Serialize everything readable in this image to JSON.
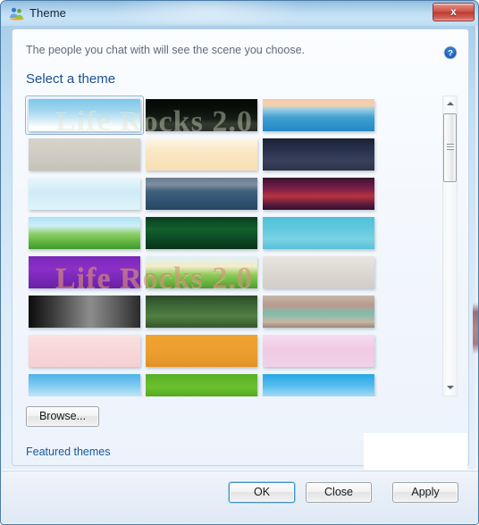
{
  "window": {
    "title": "Theme",
    "icon": "contacts-people-icon",
    "close_label": "x"
  },
  "panel": {
    "subtitle": "The people you chat with will see the scene you choose.",
    "section_title": "Select a theme",
    "help_icon": "help-question-icon"
  },
  "themes": {
    "selected_index": 0,
    "columns": 3,
    "rows_visible": 9,
    "watermark": "Life Rocks 2.0",
    "items": [
      {
        "name": "sky-blue-gradient",
        "css": "linear-gradient(to bottom,#7fc6e8 0%,#9ed6ef 34%,#cfe9f7 62%,#ffffff 88%,#f2fafd 100%)"
      },
      {
        "name": "black-dark-ridge",
        "css": "linear-gradient(to bottom,#050705 0%,#0d120d 40%,#161c16 62%,#33392f 76%,#2b2f2b 100%)"
      },
      {
        "name": "seaside-boat",
        "css": "linear-gradient(to bottom,#f7c8a8 0%,#f3d3b0 20%,#8ec9e6 34%,#3f9fd0 58%,#2489c4 100%)"
      },
      {
        "name": "grey-winter-sketch",
        "css": "linear-gradient(to bottom,#d6d3cb 0%,#cfccc3 55%,#c6c2b8 100%)"
      },
      {
        "name": "orange-bubbles-toys",
        "css": "linear-gradient(to bottom,#fdf7e8 0%,#fae7c3 40%,#f7dfb5 100%)"
      },
      {
        "name": "night-clouds",
        "css": "linear-gradient(to bottom,#1b2236 0%,#2a3350 40%,#39415c 70%,#2d3448 100%)"
      },
      {
        "name": "ice-blue-splash",
        "css": "linear-gradient(to bottom,#e9f6fb 0%,#cfecf7 45%,#dff3fa 100%)"
      },
      {
        "name": "moonlight-sea-robot",
        "css": "linear-gradient(to bottom,#6b7d90 0%,#7d8ea0 22%,#41617c 42%,#2f5472 72%,#26465f 100%)"
      },
      {
        "name": "purple-hearts",
        "css": "linear-gradient(to bottom,#3a1233 0%,#7d2049 35%,#b8343f 58%,#5d1b3e 82%,#2e1130 100%)"
      },
      {
        "name": "green-field-tree",
        "css": "linear-gradient(to bottom,#a9e2f2 0%,#cfeef7 28%,#8ed06a 52%,#5fb43f 78%,#3f9a2c 100%)"
      },
      {
        "name": "dark-green-leaves",
        "css": "linear-gradient(to bottom,#0a3d1e 0%,#12602e 38%,#0d4a24 68%,#073418 100%)"
      },
      {
        "name": "blue-bird-goggles",
        "css": "linear-gradient(to bottom,#4fc0d8 0%,#63cadf 40%,#7ad2e3 70%,#56c2d9 100%)"
      },
      {
        "name": "purple-swirl",
        "css": "linear-gradient(to bottom,#7a28b8 0%,#8b2fc9 40%,#7726b4 75%,#6a1fa4 100%)"
      },
      {
        "name": "cartoon-meadow-kid",
        "css": "linear-gradient(to bottom,#dff0f7 0%,#f3ecc9 32%,#8fca5a 58%,#69b33f 82%,#4f9c2e 100%)"
      },
      {
        "name": "graffiti-wall",
        "css": "linear-gradient(to bottom,#e9e6e1 0%,#ddd9d3 45%,#d2cdc6 100%)"
      },
      {
        "name": "greyscale-sculpture",
        "css": "linear-gradient(to right,#0b0b0b 0%,#4a4a4a 28%,#8d8d8d 55%,#5a5a5a 80%,#2a2a2a 100%)"
      },
      {
        "name": "green-bokeh-nature",
        "css": "linear-gradient(to bottom,#2c4b2a 0%,#3f6b38 35%,#50803f 65%,#33552d 100%)"
      },
      {
        "name": "abstract-pastel-art",
        "css": "linear-gradient(to bottom,#c9b7a8 0%,#b79a8e 30%,#7fbfae 58%,#c7b6a2 82%,#9a8878 100%)"
      },
      {
        "name": "cherry-blossom-pink",
        "css": "linear-gradient(to bottom,#fbe2e2 0%,#f9d7d8 45%,#f6cfd1 100%)"
      },
      {
        "name": "orange-grass",
        "css": "linear-gradient(to bottom,#f0a22f 0%,#eea031 40%,#e99a2c 72%,#e09226 100%)"
      },
      {
        "name": "pink-bubbles-dragon",
        "css": "linear-gradient(to bottom,#f7dcee 0%,#f1c9e4 45%,#efd2e8 100%)"
      },
      {
        "name": "light-blue-sky",
        "css": "linear-gradient(to bottom,#4db2e8 0%,#7ecaf0 35%,#c3e6f8 70%,#eaf6fd 100%)"
      },
      {
        "name": "fresh-green-grass",
        "css": "linear-gradient(to bottom,#57b024 0%,#6cc02e 40%,#4fa51f 75%,#3d8e18 100%)"
      },
      {
        "name": "blue-white-swan",
        "css": "linear-gradient(to bottom,#27a7e6 0%,#53bcee 35%,#9fd9f5 68%,#e6b9d8 100%)"
      }
    ]
  },
  "scrollbar": {
    "up_icon": "scroll-up-arrow-icon",
    "down_icon": "scroll-down-arrow-icon",
    "thumb_position_percent": 6
  },
  "actions": {
    "browse_label": "Browse...",
    "featured_link_label": "Featured themes",
    "ok_label": "OK",
    "close_label": "Close",
    "apply_label": "Apply"
  }
}
